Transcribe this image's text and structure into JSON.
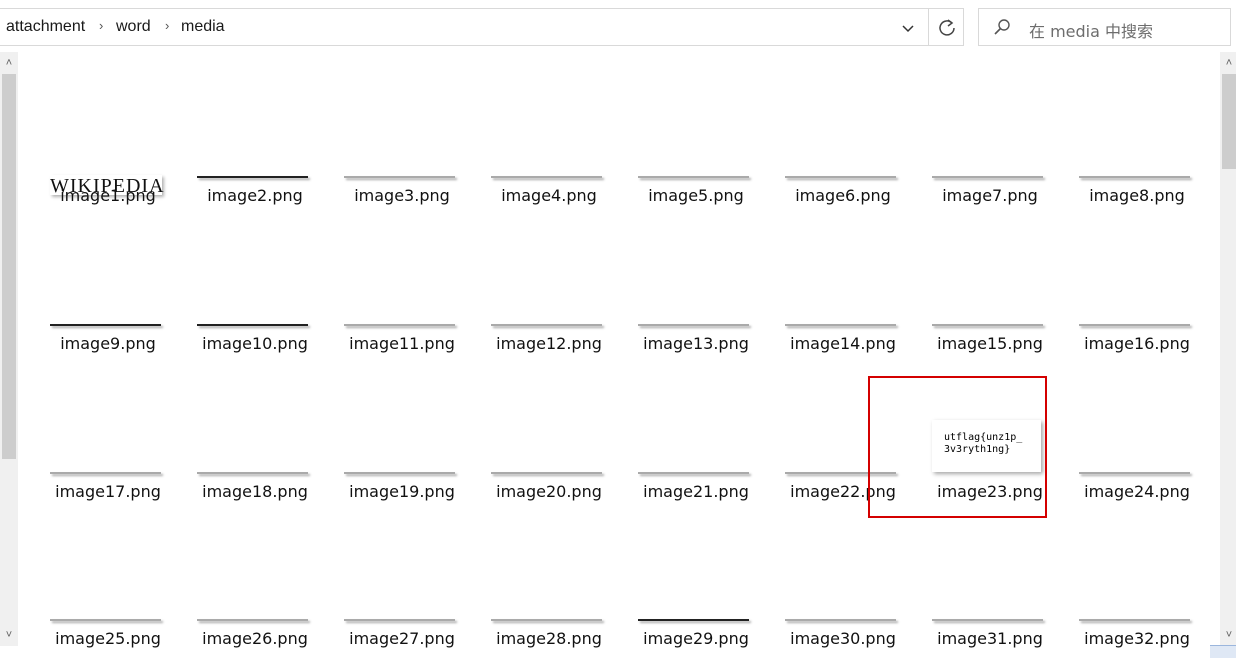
{
  "breadcrumb": [
    "attachment",
    "word",
    "media"
  ],
  "search": {
    "placeholder": "在 media 中搜索"
  },
  "thumbnail_texts": {
    "wikipedia_logo": "WIKIPEDIA",
    "image23_line1": "utflag{unz1p_",
    "image23_line2": "3v3ryth1ng}"
  },
  "files": [
    "image1.png",
    "image2.png",
    "image3.png",
    "image4.png",
    "image5.png",
    "image6.png",
    "image7.png",
    "image8.png",
    "image9.png",
    "image10.png",
    "image11.png",
    "image12.png",
    "image13.png",
    "image14.png",
    "image15.png",
    "image16.png",
    "image17.png",
    "image18.png",
    "image19.png",
    "image20.png",
    "image21.png",
    "image22.png",
    "image23.png",
    "image24.png",
    "image25.png",
    "image26.png",
    "image27.png",
    "image28.png",
    "image29.png",
    "image30.png",
    "image31.png",
    "image32.png"
  ],
  "highlight": {
    "color": "#d40000"
  },
  "icons": [
    "chevron-right-icon",
    "chevron-down-icon",
    "refresh-icon",
    "search-icon",
    "scroll-up-icon",
    "scroll-down-icon"
  ]
}
